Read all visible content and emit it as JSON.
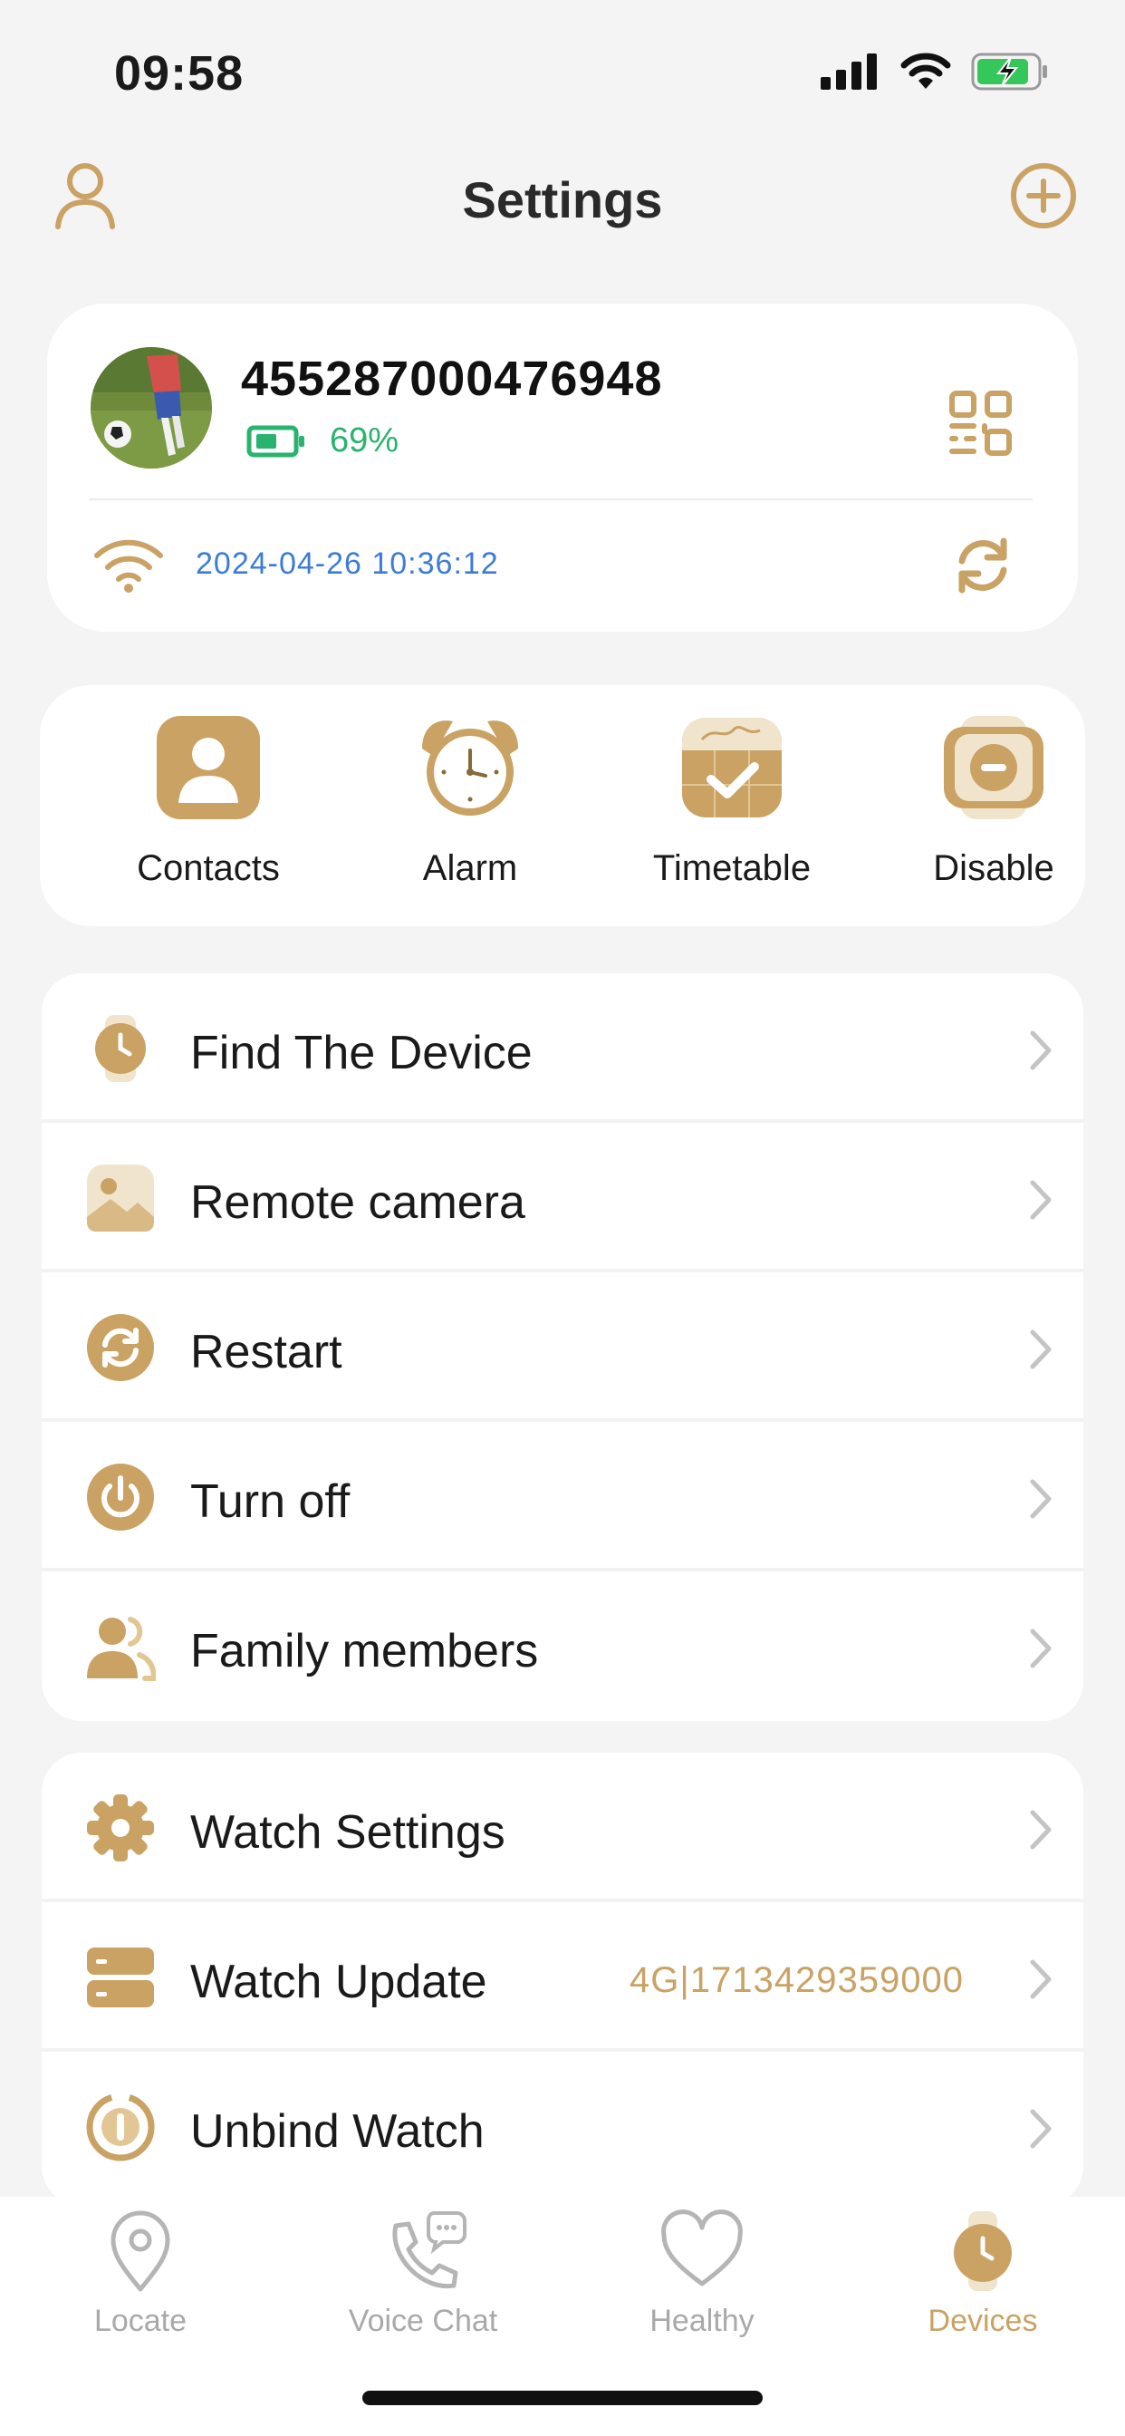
{
  "status_bar": {
    "time": "09:58"
  },
  "header": {
    "title": "Settings"
  },
  "device": {
    "id": "455287000476948",
    "battery": "69%",
    "timestamp": "2024-04-26 10:36:12"
  },
  "quick_actions": [
    {
      "label": "Contacts",
      "icon": "contacts-icon"
    },
    {
      "label": "Alarm",
      "icon": "alarm-clock-icon"
    },
    {
      "label": "Timetable",
      "icon": "timetable-icon"
    },
    {
      "label": "Disable",
      "icon": "disable-watch-icon"
    }
  ],
  "group1": [
    {
      "label": "Find The Device",
      "icon": "watch-icon"
    },
    {
      "label": "Remote camera",
      "icon": "photo-icon"
    },
    {
      "label": "Restart",
      "icon": "restart-icon"
    },
    {
      "label": "Turn off",
      "icon": "power-icon"
    },
    {
      "label": "Family members",
      "icon": "family-icon"
    }
  ],
  "group2": [
    {
      "label": "Watch Settings",
      "icon": "gear-icon"
    },
    {
      "label": "Watch Update",
      "icon": "update-icon",
      "value": "4G|1713429359000"
    },
    {
      "label": "Unbind Watch",
      "icon": "unbind-icon"
    }
  ],
  "tabs": [
    {
      "label": "Locate",
      "icon": "location-pin-icon"
    },
    {
      "label": "Voice Chat",
      "icon": "voice-chat-icon"
    },
    {
      "label": "Healthy",
      "icon": "heart-icon"
    },
    {
      "label": "Devices",
      "icon": "devices-watch-icon",
      "active": true
    }
  ],
  "colors": {
    "accent": "#c9a264",
    "battery_green": "#2ab36e",
    "timestamp_blue": "#3e7bd8",
    "background": "#f4f4f4"
  }
}
